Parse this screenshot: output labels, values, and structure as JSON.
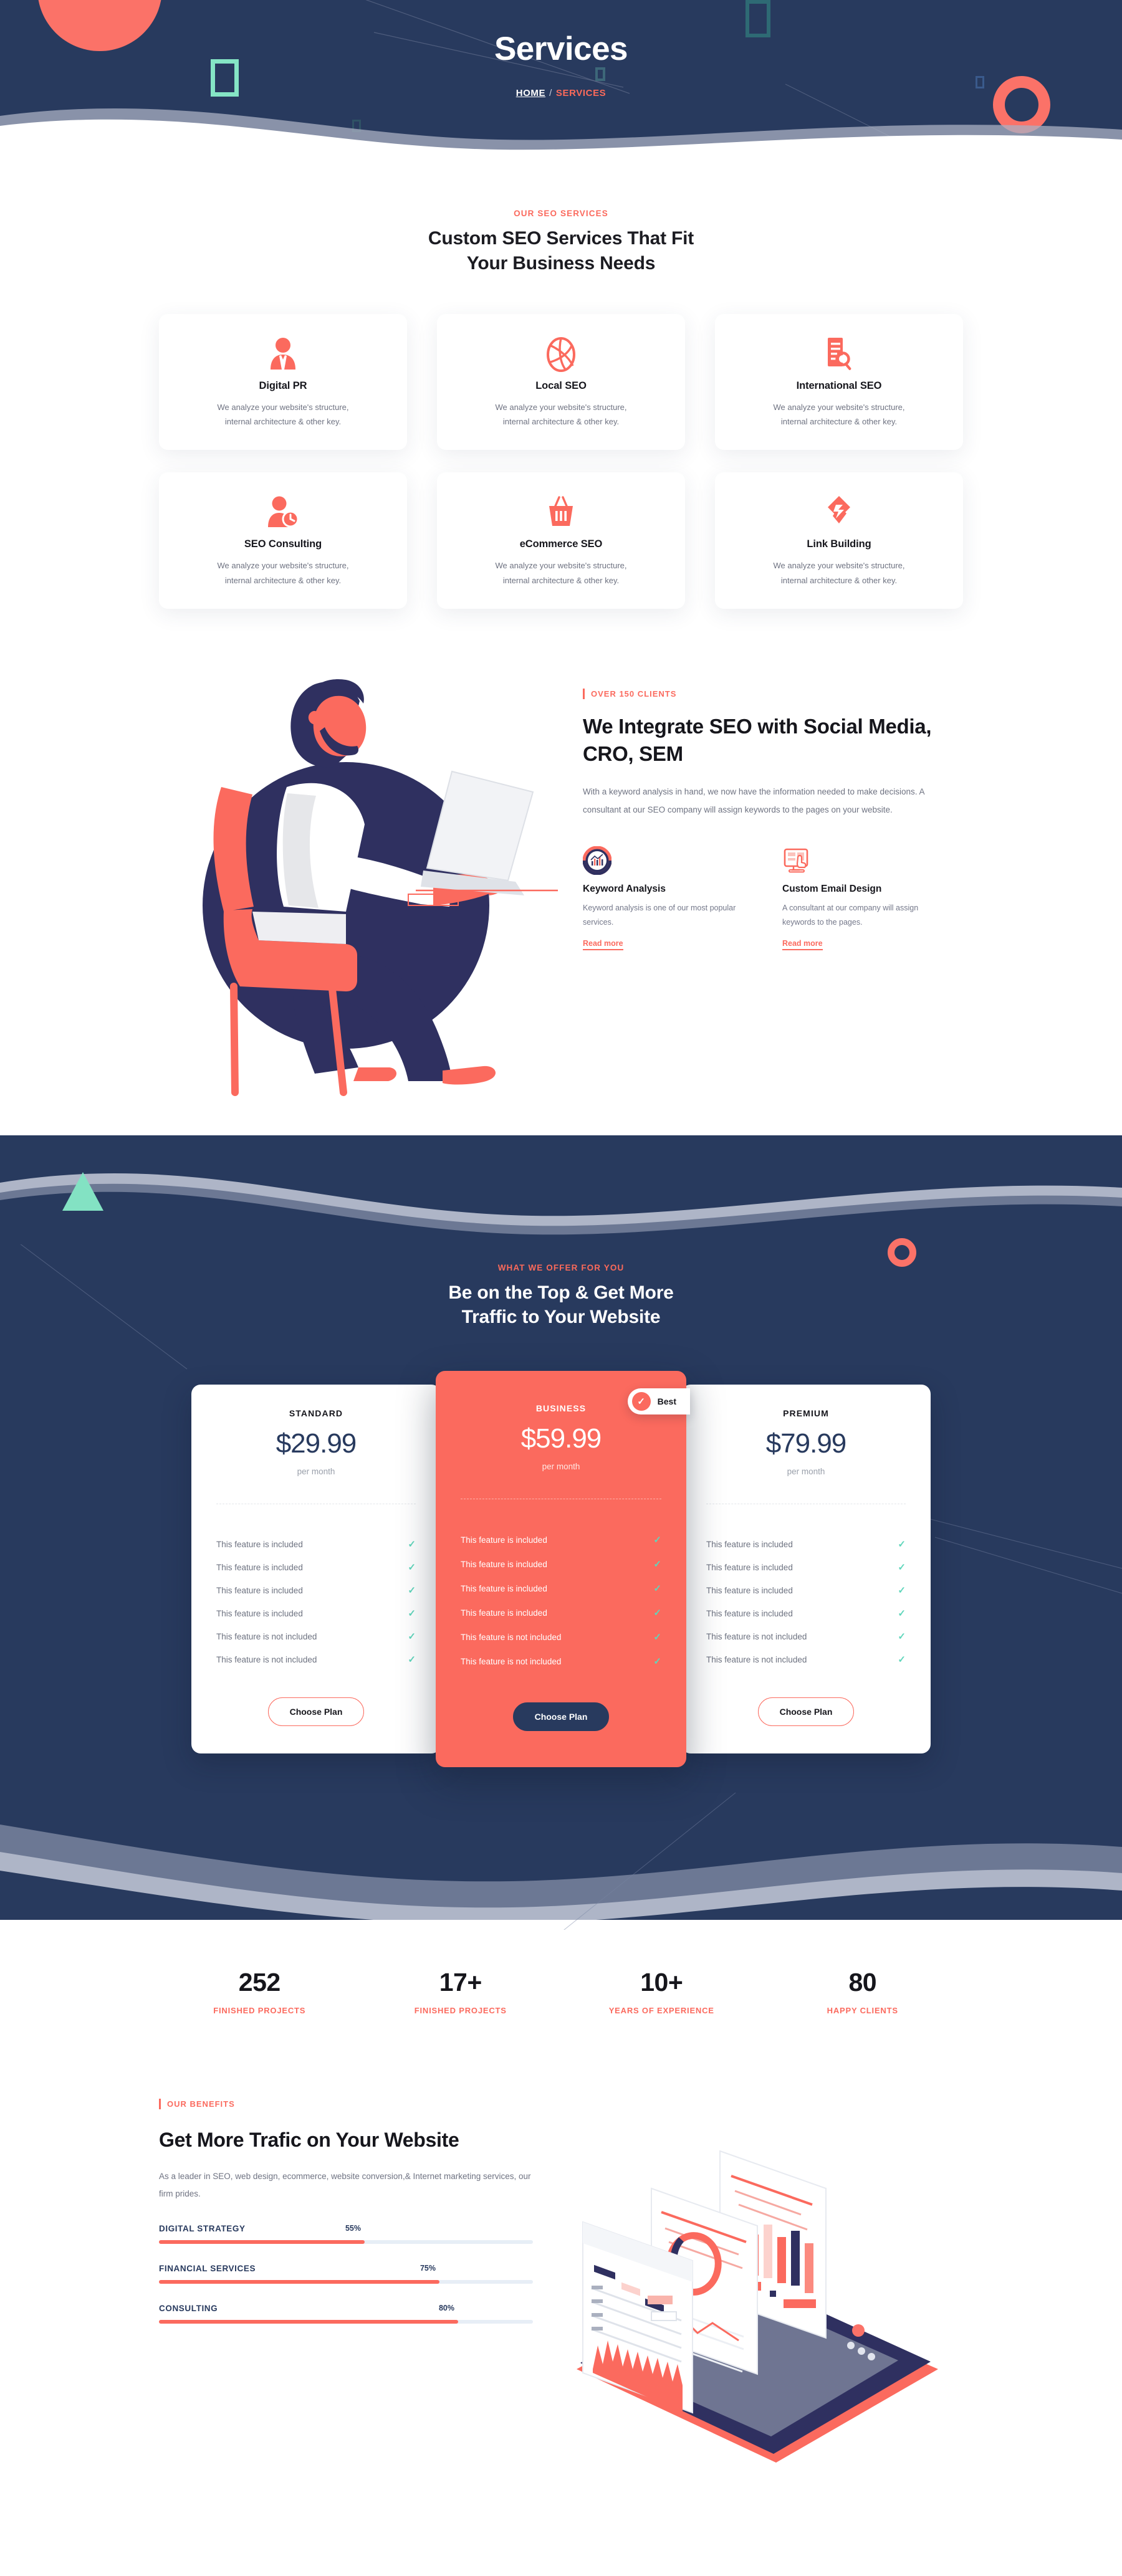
{
  "hero": {
    "title": "Services",
    "breadcrumb_home": "HOME",
    "breadcrumb_sep": "/",
    "breadcrumb_current": "SERVICES"
  },
  "services": {
    "eyebrow": "OUR SEO SERVICES",
    "title_line1": "Custom SEO Services That Fit",
    "title_line2": "Your Business Needs",
    "cards": [
      {
        "icon": "user-tie-icon",
        "name": "Digital PR",
        "desc_line1": "We analyze your website's structure,",
        "desc_line2": "internal architecture & other key."
      },
      {
        "icon": "dribbble-ball-icon",
        "name": "Local SEO",
        "desc_line1": "We analyze your website's structure,",
        "desc_line2": "internal architecture & other key."
      },
      {
        "icon": "document-search-icon",
        "name": "International SEO",
        "desc_line1": "We analyze your website's structure,",
        "desc_line2": "internal architecture & other key."
      },
      {
        "icon": "user-clock-icon",
        "name": "SEO Consulting",
        "desc_line1": "We analyze your website's structure,",
        "desc_line2": "internal architecture & other key."
      },
      {
        "icon": "shopping-basket-icon",
        "name": "eCommerce SEO",
        "desc_line1": "We analyze your website's structure,",
        "desc_line2": "internal architecture & other key."
      },
      {
        "icon": "link-chain-icon",
        "name": "Link Building",
        "desc_line1": "We analyze your website's structure,",
        "desc_line2": "internal architecture & other key."
      }
    ]
  },
  "integrate": {
    "eyebrow": "OVER 150 CLIENTS",
    "heading": "We Integrate SEO with Social Media, CRO, SEM",
    "paragraph": "With a keyword analysis in hand, we now have the information needed to make decisions. A consultant at our SEO company will assign keywords to the pages on your website.",
    "features": [
      {
        "icon": "donut-chart-icon",
        "title": "Keyword Analysis",
        "desc": "Keyword analysis is one of our most popular services.",
        "link": "Read more"
      },
      {
        "icon": "monitor-click-icon",
        "title": "Custom Email Design",
        "desc": "A consultant at our company will assign keywords to the pages.",
        "link": "Read more"
      }
    ]
  },
  "pricing": {
    "eyebrow": "WHAT WE OFFER FOR YOU",
    "title_line1": "Be on the Top & Get More",
    "title_line2": "Traffic to Your Website",
    "badge_label": "Best",
    "badge_icon": "check-circle-icon",
    "plans": [
      {
        "name": "STANDARD",
        "price": "$29.99",
        "period": "per month",
        "featured": false,
        "button": "Choose Plan",
        "features": [
          "This feature is included",
          "This feature is included",
          "This feature is included",
          "This feature is included",
          "This feature is not included",
          "This feature is not included"
        ]
      },
      {
        "name": "BUSINESS",
        "price": "$59.99",
        "period": "per month",
        "featured": true,
        "button": "Choose Plan",
        "features": [
          "This feature is included",
          "This feature is included",
          "This feature is included",
          "This feature is included",
          "This feature is not included",
          "This feature is not included"
        ]
      },
      {
        "name": "PREMIUM",
        "price": "$79.99",
        "period": "per month",
        "featured": false,
        "button": "Choose Plan",
        "features": [
          "This feature is included",
          "This feature is included",
          "This feature is included",
          "This feature is included",
          "This feature is not included",
          "This feature is not included"
        ]
      }
    ]
  },
  "counters": [
    {
      "value": "252",
      "label": "FINISHED PROJECTS"
    },
    {
      "value": "17+",
      "label": "FINISHED PROJECTS"
    },
    {
      "value": "10+",
      "label": "YEARS OF EXPERIENCE"
    },
    {
      "value": "80",
      "label": "HAPPY CLIENTS"
    }
  ],
  "benefits": {
    "eyebrow": "OUR BENEFITS",
    "heading": "Get More Trafic on Your Website",
    "paragraph": "As a leader in SEO, web design, ecommerce, website conversion,& Internet marketing services, our firm prides.",
    "skills": [
      {
        "name": "DIGITAL STRATEGY",
        "percent": "55%",
        "value": 55
      },
      {
        "name": "FINANCIAL SERVICES",
        "percent": "75%",
        "value": 75
      },
      {
        "name": "CONSULTING",
        "percent": "80%",
        "value": 80
      }
    ]
  },
  "colors": {
    "accent": "#fb6a5e",
    "navy": "#283a5e",
    "mint": "#83e2c3",
    "tick": "#5fd6bb",
    "muted": "#6f7382"
  }
}
